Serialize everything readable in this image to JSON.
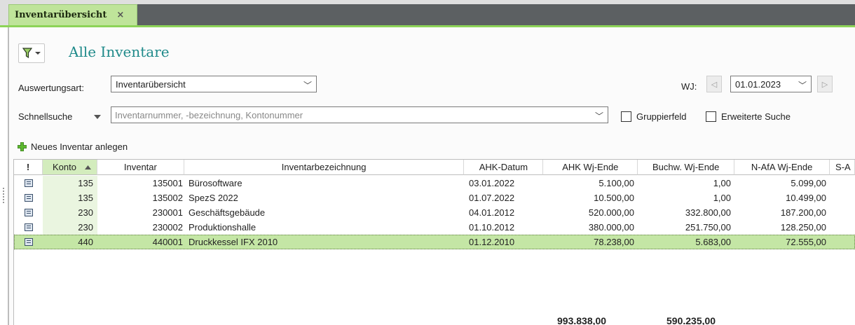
{
  "tab": {
    "label": "Inventarübersicht",
    "close": "×"
  },
  "header": {
    "title": "Alle Inventare"
  },
  "filters": {
    "auswertungsart_label": "Auswertungsart:",
    "auswertungsart_value": "Inventarübersicht",
    "wj_label": "WJ:",
    "wj_value": "01.01.2023",
    "schnellsuche_label": "Schnellsuche",
    "search_placeholder": "Inventarnummer, -bezeichnung, Kontonummer",
    "gruppierfeld_label": "Gruppierfeld",
    "erweiterte_label": "Erweiterte Suche"
  },
  "toolbar": {
    "new_label": "Neues Inventar anlegen"
  },
  "grid": {
    "columns": [
      "!",
      "Konto",
      "Inventar",
      "Inventarbezeichnung",
      "AHK-Datum",
      "AHK Wj-Ende",
      "Buchw. Wj-Ende",
      "N-AfA Wj-Ende",
      "S-A"
    ],
    "rows": [
      {
        "konto": "135",
        "inventar": "135001",
        "bezeichnung": "Bürosoftware",
        "datum": "03.01.2022",
        "ahk": "5.100,00",
        "buchw": "1,00",
        "nafa": "5.099,00"
      },
      {
        "konto": "135",
        "inventar": "135002",
        "bezeichnung": "SpezS 2022",
        "datum": "01.07.2022",
        "ahk": "10.500,00",
        "buchw": "1,00",
        "nafa": "10.499,00"
      },
      {
        "konto": "230",
        "inventar": "230001",
        "bezeichnung": "Geschäftsgebäude",
        "datum": "04.01.2012",
        "ahk": "520.000,00",
        "buchw": "332.800,00",
        "nafa": "187.200,00"
      },
      {
        "konto": "230",
        "inventar": "230002",
        "bezeichnung": "Produktionshalle",
        "datum": "01.10.2012",
        "ahk": "380.000,00",
        "buchw": "251.750,00",
        "nafa": "128.250,00"
      },
      {
        "konto": "440",
        "inventar": "440001",
        "bezeichnung": "Druckkessel IFX 2010",
        "datum": "01.12.2010",
        "ahk": "78.238,00",
        "buchw": "5.683,00",
        "nafa": "72.555,00"
      }
    ],
    "totals": {
      "ahk": "993.838,00",
      "buchw": "590.235,00"
    }
  },
  "colors": {
    "accent": "#8dd358",
    "tab_bg": "#bfe49a",
    "title": "#1f8a8a",
    "selected_row": "#c4e6a5"
  }
}
